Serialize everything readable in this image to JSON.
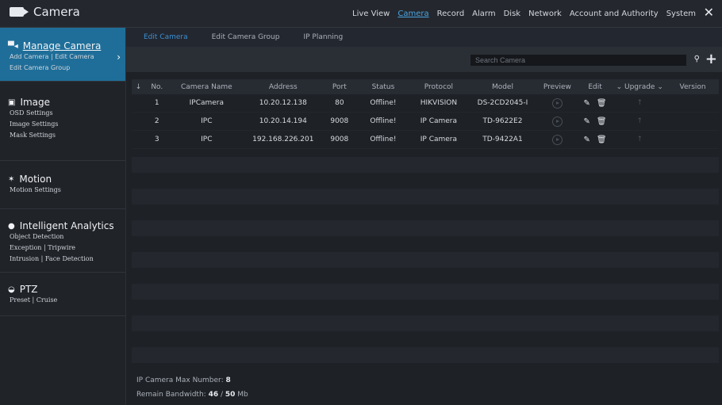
{
  "app": {
    "title": "Camera"
  },
  "nav": [
    "Live View",
    "Camera",
    "Record",
    "Alarm",
    "Disk",
    "Network",
    "Account and Authority",
    "System"
  ],
  "nav_active": "Camera",
  "sidebar": {
    "manage": {
      "title": "Manage Camera",
      "l1a": "Add Camera",
      "l1b": "Edit Camera",
      "l2": "Edit Camera Group"
    },
    "image": {
      "title": "Image",
      "l1": "OSD Settings",
      "l2": "Image Settings",
      "l3": "Mask Settings"
    },
    "motion": {
      "title": "Motion",
      "l1": "Motion Settings"
    },
    "analytics": {
      "title": "Intelligent Analytics",
      "l1": "Object Detection",
      "l2a": "Exception",
      "l2b": "Tripwire",
      "l3a": "Intrusion",
      "l3b": "Face Detection"
    },
    "ptz": {
      "title": "PTZ",
      "l1a": "Preset",
      "l1b": "Cruise"
    }
  },
  "tabs": [
    "Edit Camera",
    "Edit Camera Group",
    "IP Planning"
  ],
  "search": {
    "placeholder": "Search Camera"
  },
  "table": {
    "headers": [
      "No.",
      "Camera Name",
      "Address",
      "Port",
      "Status",
      "Protocol",
      "Model",
      "Preview",
      "Edit",
      "Upgrade",
      "Version"
    ],
    "rows": [
      {
        "no": "1",
        "name": "IPCamera",
        "address": "10.20.12.138",
        "port": "80",
        "status": "Offline!",
        "protocol": "HIKVISION",
        "model": "DS-2CD2045-I"
      },
      {
        "no": "2",
        "name": "IPC",
        "address": "10.20.14.194",
        "port": "9008",
        "status": "Offline!",
        "protocol": "IP Camera",
        "model": "TD-9622E2"
      },
      {
        "no": "3",
        "name": "IPC",
        "address": "192.168.226.201",
        "port": "9008",
        "status": "Offline!",
        "protocol": "IP Camera",
        "model": "TD-9422A1"
      }
    ]
  },
  "footer": {
    "max_label": "IP Camera Max Number:",
    "max_value": "8",
    "bw_label": "Remain Bandwidth:",
    "bw_used": "46",
    "bw_total": "50",
    "bw_unit": "Mb"
  }
}
